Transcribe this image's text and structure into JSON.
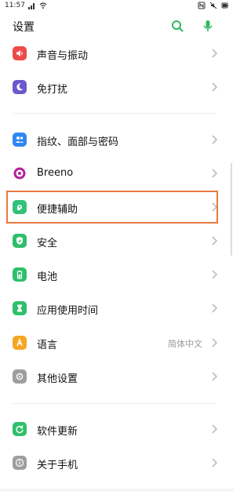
{
  "status": {
    "time": "11:57"
  },
  "header": {
    "title": "设置"
  },
  "colors": {
    "accent": "#30b764",
    "highlight_border": "#e9793f"
  },
  "items": [
    {
      "name": "sound-vibration",
      "label": "声音与振动",
      "icon": "speaker-icon",
      "icon_color": "#ee4a4a"
    },
    {
      "name": "do-not-disturb",
      "label": "免打扰",
      "icon": "moon-icon",
      "icon_color": "#6a5acd"
    },
    {
      "name": "fingerprint-face-password",
      "label": "指纹、面部与密码",
      "icon": "users-icon",
      "icon_color": "#2f87f2"
    },
    {
      "name": "breeno",
      "label": "Breeno",
      "icon": "breeno-icon",
      "icon_color": "#b0219b"
    },
    {
      "name": "accessibility",
      "label": "便捷辅助",
      "icon": "accessibility-icon",
      "icon_color": "#33c27a"
    },
    {
      "name": "security",
      "label": "安全",
      "icon": "shield-icon",
      "icon_color": "#2fbf6b"
    },
    {
      "name": "battery",
      "label": "电池",
      "icon": "battery-icon",
      "icon_color": "#2fbf6b"
    },
    {
      "name": "app-usage-time",
      "label": "应用使用时间",
      "icon": "hourglass-icon",
      "icon_color": "#2fbf6b"
    },
    {
      "name": "language",
      "label": "语言",
      "value": "简体中文",
      "icon": "language-icon",
      "icon_color": "#f4a623"
    },
    {
      "name": "other-settings",
      "label": "其他设置",
      "icon": "dots-icon",
      "icon_color": "#9e9e9e"
    },
    {
      "name": "software-update",
      "label": "软件更新",
      "icon": "update-icon",
      "icon_color": "#2fbf6b"
    },
    {
      "name": "about-phone",
      "label": "关于手机",
      "icon": "info-icon",
      "icon_color": "#9e9e9e"
    }
  ]
}
